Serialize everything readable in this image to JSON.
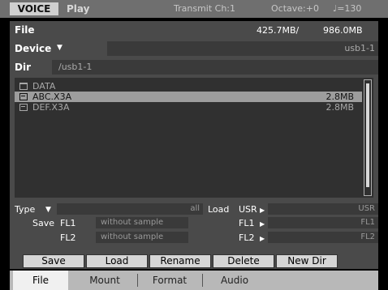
{
  "topbar": {
    "mode": "VOICE",
    "play": "Play",
    "transmit": "Transmit Ch:1",
    "octave": "Octave:+0",
    "tempo": "♩=130"
  },
  "file_row": {
    "label": "File",
    "used": "425.7MB/",
    "total": "986.0MB"
  },
  "device": {
    "label": "Device",
    "value": "usb1-1"
  },
  "dir": {
    "label": "Dir",
    "value": "/usb1-1"
  },
  "files": [
    {
      "type": "folder",
      "name": "DATA",
      "size": "",
      "selected": false
    },
    {
      "type": "file",
      "name": "ABC.X3A",
      "size": "2.8MB",
      "selected": true
    },
    {
      "type": "file",
      "name": "DEF.X3A",
      "size": "2.8MB",
      "selected": false
    }
  ],
  "type_row": {
    "label": "Type",
    "value": "all"
  },
  "save": {
    "label": "Save",
    "fl1_label": "FL1",
    "fl1_value": "without sample",
    "fl2_label": "FL2",
    "fl2_value": "without sample"
  },
  "load": {
    "label": "Load",
    "usr_label": "USR",
    "usr_value": "USR",
    "fl1_label": "FL1",
    "fl1_value": "FL1",
    "fl2_label": "FL2",
    "fl2_value": "FL2"
  },
  "buttons": {
    "save": "Save",
    "load": "Load",
    "rename": "Rename",
    "delete": "Delete",
    "new_dir": "New Dir"
  },
  "tabs": {
    "file": "File",
    "mount": "Mount",
    "format": "Format",
    "audio": "Audio"
  }
}
